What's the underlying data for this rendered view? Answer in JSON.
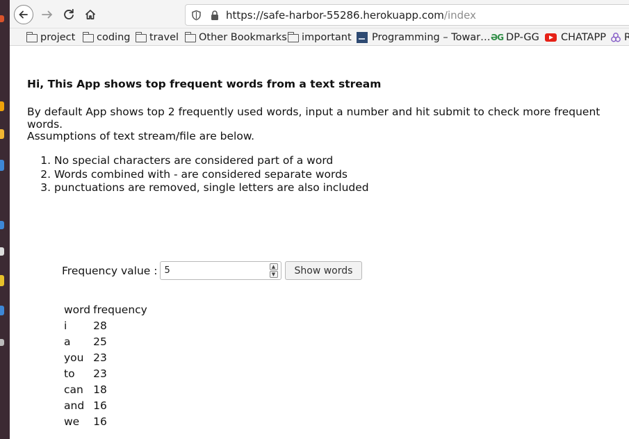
{
  "browser": {
    "url_host": "https://safe-harbor-55286.herokuapp.com",
    "url_path": "/index",
    "bookmarks": [
      {
        "label": "project",
        "icon": "folder-icon"
      },
      {
        "label": "coding",
        "icon": "folder-icon"
      },
      {
        "label": "travel",
        "icon": "folder-icon"
      },
      {
        "label": "Other Bookmarks",
        "icon": "folder-icon"
      },
      {
        "label": "important",
        "icon": "folder-icon"
      },
      {
        "label": "Programming – Towar…",
        "icon": "tds-icon"
      },
      {
        "label": "DP-GG",
        "icon": "gfg-icon",
        "icon_text": "ƏG"
      },
      {
        "label": "CHATAPP",
        "icon": "youtube-icon"
      },
      {
        "label": "R",
        "icon": "hub-icon"
      }
    ]
  },
  "page": {
    "headline": "Hi, This App shows top frequent words from a text stream",
    "intro": "By default App shows top 2 frequently used words, input a number and hit submit to check more frequent words.",
    "assumptions_title": "Assumptions of text stream/file are below.",
    "rules": [
      "No special characters are considered part of a word",
      "Words combined with - are considered separate words",
      "punctuations are removed, single letters are also included"
    ],
    "form": {
      "label": "Frequency value :",
      "value": "5",
      "button": "Show words"
    },
    "table": {
      "headers": [
        "word",
        "frequency"
      ],
      "rows": [
        [
          "i",
          "28"
        ],
        [
          "a",
          "25"
        ],
        [
          "you",
          "23"
        ],
        [
          "to",
          "23"
        ],
        [
          "can",
          "18"
        ],
        [
          "and",
          "16"
        ],
        [
          "we",
          "16"
        ]
      ]
    }
  },
  "colors": {
    "dock": "#3c2a33",
    "toolbar": "#f4f4f4",
    "youtube_red": "#e62117",
    "gfg_green": "#2f8d46"
  }
}
